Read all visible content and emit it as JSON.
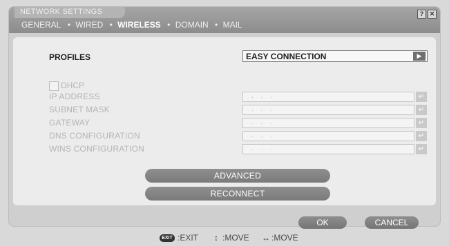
{
  "window": {
    "title": "NETWORK SETTINGS",
    "help_label": "?",
    "close_label": "✕"
  },
  "tabs": [
    {
      "label": "GENERAL"
    },
    {
      "label": "WIRED"
    },
    {
      "label": "WIRELESS"
    },
    {
      "label": "DOMAIN"
    },
    {
      "label": "MAIL"
    }
  ],
  "tab_separator": "•",
  "active_tab": "WIRELESS",
  "profiles": {
    "label": "PROFILES",
    "value": "EASY CONNECTION",
    "arrow": "▶"
  },
  "dhcp": {
    "label": "DHCP",
    "checked": false
  },
  "fields": [
    {
      "label": "IP ADDRESS",
      "value": ". . ."
    },
    {
      "label": "SUBNET MASK",
      "value": ". . ."
    },
    {
      "label": "GATEWAY",
      "value": ". . ."
    },
    {
      "label": "DNS CONFIGURATION",
      "value": ". . ."
    },
    {
      "label": "WINS CONFIGURATION",
      "value": ". . ."
    }
  ],
  "enter_glyph": "↵",
  "buttons": {
    "advanced": "ADVANCED",
    "reconnect": "RECONNECT",
    "ok": "OK",
    "cancel": "CANCEL"
  },
  "footer": {
    "exit_key": "EXIT",
    "exit_text": ":EXIT",
    "move_v_glyph": "↕",
    "move_v_text": ":MOVE",
    "move_h_glyph": "↔",
    "move_h_text": ":MOVE"
  }
}
